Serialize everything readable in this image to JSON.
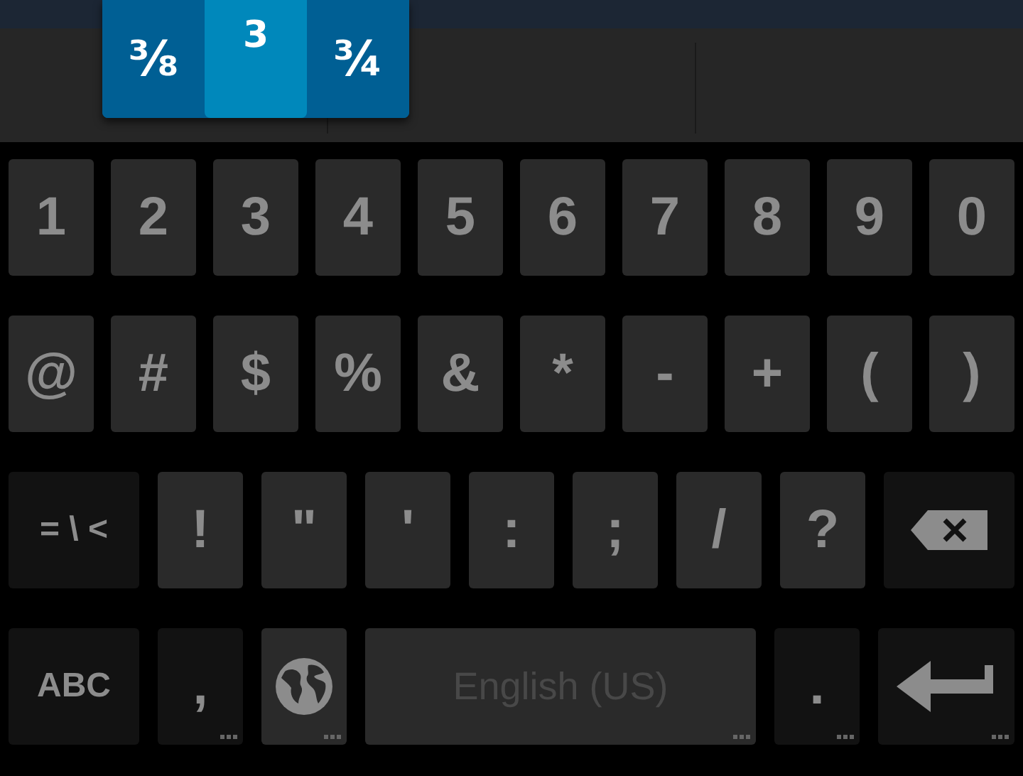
{
  "suggestions": [
    {
      "label": "⅜",
      "selected": false
    },
    {
      "label": "3",
      "selected": true
    },
    {
      "label": "¾",
      "selected": false
    }
  ],
  "rows": [
    {
      "keys": [
        {
          "kind": "char",
          "label": "1"
        },
        {
          "kind": "char",
          "label": "2"
        },
        {
          "kind": "char",
          "label": "3"
        },
        {
          "kind": "char",
          "label": "4"
        },
        {
          "kind": "char",
          "label": "5"
        },
        {
          "kind": "char",
          "label": "6"
        },
        {
          "kind": "char",
          "label": "7"
        },
        {
          "kind": "char",
          "label": "8"
        },
        {
          "kind": "char",
          "label": "9"
        },
        {
          "kind": "char",
          "label": "0"
        }
      ]
    },
    {
      "keys": [
        {
          "kind": "char",
          "label": "@"
        },
        {
          "kind": "char",
          "label": "#"
        },
        {
          "kind": "char",
          "label": "$"
        },
        {
          "kind": "char",
          "label": "%"
        },
        {
          "kind": "char",
          "label": "&"
        },
        {
          "kind": "char",
          "label": "*"
        },
        {
          "kind": "char",
          "label": "-"
        },
        {
          "kind": "char",
          "label": "+"
        },
        {
          "kind": "char",
          "label": "("
        },
        {
          "kind": "char",
          "label": ")"
        }
      ]
    },
    {
      "keys": [
        {
          "kind": "mode",
          "label": "= \\ <"
        },
        {
          "kind": "char",
          "label": "!"
        },
        {
          "kind": "char",
          "label": "\""
        },
        {
          "kind": "char",
          "label": "'"
        },
        {
          "kind": "char",
          "label": ":"
        },
        {
          "kind": "char",
          "label": ";"
        },
        {
          "kind": "char",
          "label": "/"
        },
        {
          "kind": "char",
          "label": "?"
        },
        {
          "kind": "backspace"
        }
      ]
    },
    {
      "keys": [
        {
          "kind": "mode",
          "label": "ABC"
        },
        {
          "kind": "punct",
          "label": ",",
          "hint": true
        },
        {
          "kind": "globe",
          "hint": true
        },
        {
          "kind": "space",
          "label": "English (US)",
          "hint": true
        },
        {
          "kind": "punct",
          "label": ".",
          "hint": true
        },
        {
          "kind": "enter",
          "hint": true
        }
      ]
    }
  ]
}
